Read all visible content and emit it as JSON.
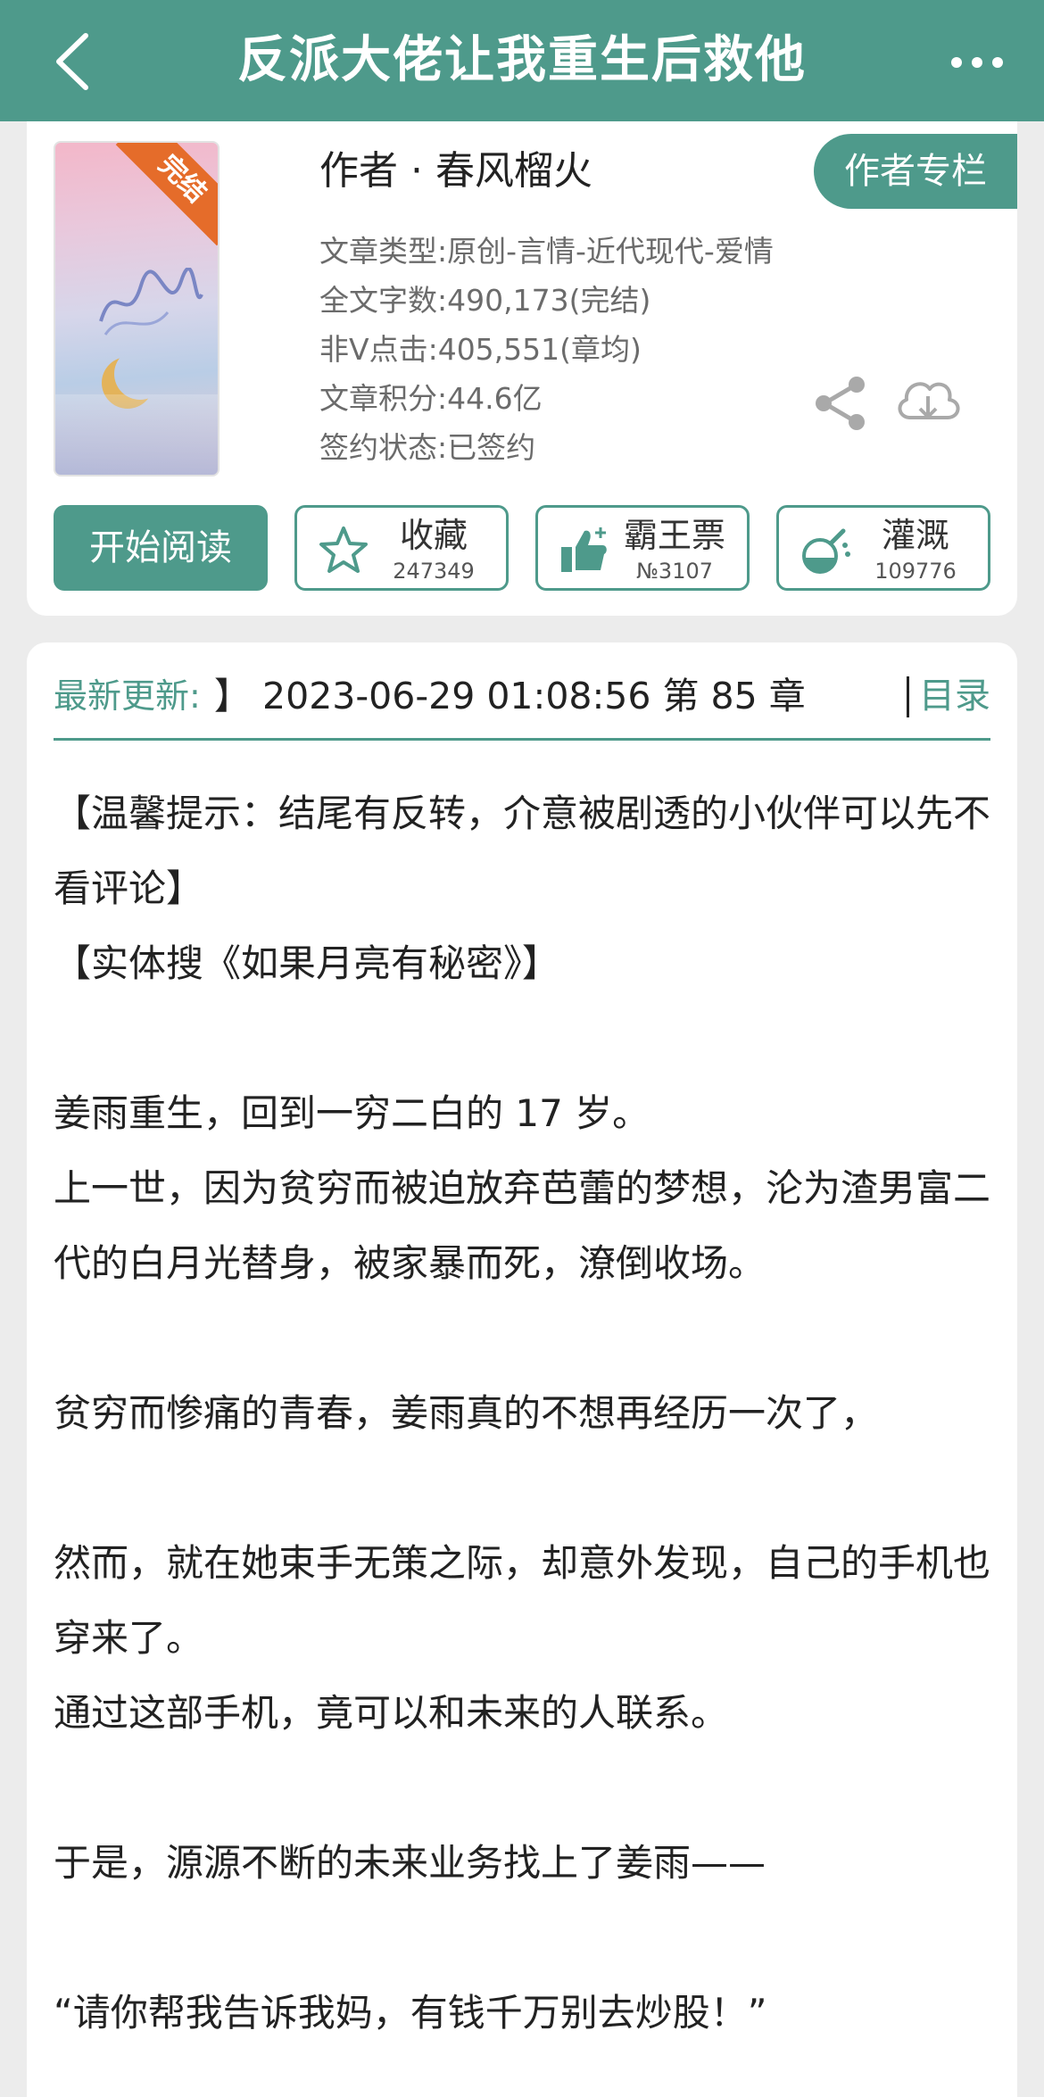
{
  "header": {
    "title": "反派大佬让我重生后救他",
    "back_icon": "chevron-left-icon",
    "more_icon": "more-horizontal-icon"
  },
  "book": {
    "cover_badge": "完结",
    "author": "作者 · 春风榴火",
    "author_column_label": "作者专栏",
    "meta": {
      "type": "文章类型:原创-言情-近代现代-爱情",
      "word_count": "全文字数:490,173(完结)",
      "clicks": "非Ⅴ点击:405,551(章均)",
      "score": "文章积分:44.6亿",
      "sign_status": "签约状态:已签约"
    }
  },
  "actions": {
    "read_label": "开始阅读",
    "favorite": {
      "label": "收藏",
      "count": "247349",
      "icon": "star-icon"
    },
    "vote": {
      "label": "霸王票",
      "count": "№3107",
      "icon": "thumbs-up-icon"
    },
    "water": {
      "label": "灌溉",
      "count": "109776",
      "icon": "watering-flask-icon"
    }
  },
  "update": {
    "label": "最新更新:",
    "text": "】 2023-06-29 01:08:56   第 85 章",
    "toc_label": "目录"
  },
  "synopsis": [
    "【温馨提示：结尾有反转，介意被剧透的小伙伴可以先不看评论】",
    "【实体搜《如果月亮有秘密》】",
    "",
    "姜雨重生，回到一穷二白的 17 岁。",
    "上一世，因为贫穷而被迫放弃芭蕾的梦想，沦为渣男富二代的白月光替身，被家暴而死，潦倒收场。",
    "",
    "贫穷而惨痛的青春，姜雨真的不想再经历一次了，",
    "",
    "然而，就在她束手无策之际，却意外发现，自己的手机也穿来了。",
    "通过这部手机，竟可以和未来的人联系。",
    "",
    "于是，源源不断的未来业务找上了姜雨——",
    "",
    "“请你帮我告诉我妈，有钱千万别去炒股！”"
  ],
  "colors": {
    "accent": "#4e9a8b",
    "badge": "#e56c2a",
    "background": "#ececec"
  }
}
